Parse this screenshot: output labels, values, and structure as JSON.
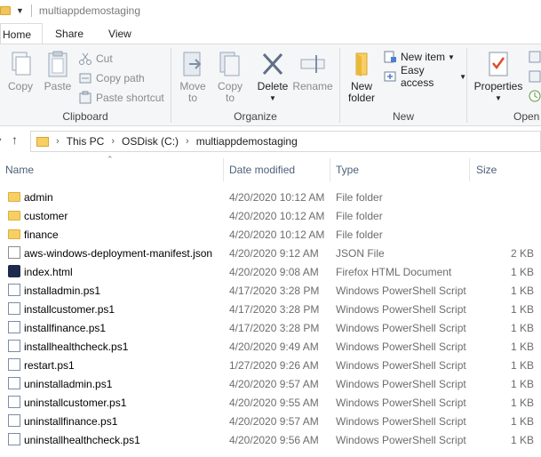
{
  "window": {
    "title": "multiappdemostaging"
  },
  "tabs": [
    {
      "label": "Home"
    },
    {
      "label": "Share"
    },
    {
      "label": "View"
    }
  ],
  "ribbon": {
    "clipboard": {
      "label": "Clipboard",
      "copy": "Copy",
      "paste": "Paste",
      "cut": "Cut",
      "copy_path": "Copy path",
      "paste_shortcut": "Paste shortcut"
    },
    "organize": {
      "label": "Organize",
      "move_to_line1": "Move",
      "move_to_line2": "to",
      "copy_to_line1": "Copy",
      "copy_to_line2": "to",
      "delete": "Delete",
      "rename": "Rename"
    },
    "new": {
      "label": "New",
      "new_folder_line1": "New",
      "new_folder_line2": "folder",
      "new_item": "New item",
      "easy_access": "Easy access"
    },
    "open": {
      "label": "Open",
      "properties": "Properties"
    }
  },
  "address": {
    "crumbs": [
      "This PC",
      "OSDisk (C:)",
      "multiappdemostaging"
    ]
  },
  "columns": {
    "name": "Name",
    "date": "Date modified",
    "type": "Type",
    "size": "Size"
  },
  "files": [
    {
      "name": "admin",
      "date": "4/20/2020 10:12 AM",
      "type": "File folder",
      "size": "",
      "kind": "folder"
    },
    {
      "name": "customer",
      "date": "4/20/2020 10:12 AM",
      "type": "File folder",
      "size": "",
      "kind": "folder"
    },
    {
      "name": "finance",
      "date": "4/20/2020 10:12 AM",
      "type": "File folder",
      "size": "",
      "kind": "folder"
    },
    {
      "name": "aws-windows-deployment-manifest.json",
      "date": "4/20/2020 9:12 AM",
      "type": "JSON File",
      "size": "2 KB",
      "kind": "json"
    },
    {
      "name": "index.html",
      "date": "4/20/2020 9:08 AM",
      "type": "Firefox HTML Document",
      "size": "1 KB",
      "kind": "html"
    },
    {
      "name": "installadmin.ps1",
      "date": "4/17/2020 3:28 PM",
      "type": "Windows PowerShell Script",
      "size": "1 KB",
      "kind": "ps"
    },
    {
      "name": "installcustomer.ps1",
      "date": "4/17/2020 3:28 PM",
      "type": "Windows PowerShell Script",
      "size": "1 KB",
      "kind": "ps"
    },
    {
      "name": "installfinance.ps1",
      "date": "4/17/2020 3:28 PM",
      "type": "Windows PowerShell Script",
      "size": "1 KB",
      "kind": "ps"
    },
    {
      "name": "installhealthcheck.ps1",
      "date": "4/20/2020 9:49 AM",
      "type": "Windows PowerShell Script",
      "size": "1 KB",
      "kind": "ps"
    },
    {
      "name": "restart.ps1",
      "date": "1/27/2020 9:26 AM",
      "type": "Windows PowerShell Script",
      "size": "1 KB",
      "kind": "ps"
    },
    {
      "name": "uninstalladmin.ps1",
      "date": "4/20/2020 9:57 AM",
      "type": "Windows PowerShell Script",
      "size": "1 KB",
      "kind": "ps"
    },
    {
      "name": "uninstallcustomer.ps1",
      "date": "4/20/2020 9:55 AM",
      "type": "Windows PowerShell Script",
      "size": "1 KB",
      "kind": "ps"
    },
    {
      "name": "uninstallfinance.ps1",
      "date": "4/20/2020 9:57 AM",
      "type": "Windows PowerShell Script",
      "size": "1 KB",
      "kind": "ps"
    },
    {
      "name": "uninstallhealthcheck.ps1",
      "date": "4/20/2020 9:56 AM",
      "type": "Windows PowerShell Script",
      "size": "1 KB",
      "kind": "ps"
    }
  ]
}
